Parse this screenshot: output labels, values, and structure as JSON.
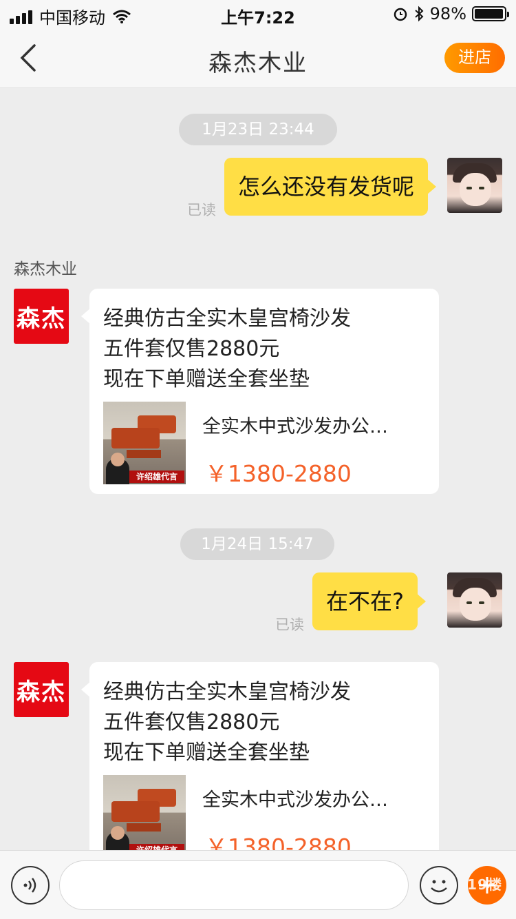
{
  "status_bar": {
    "carrier": "中国移动",
    "time": "上午7:22",
    "battery": "98%",
    "battery_level": 0.98
  },
  "nav": {
    "title": "森杰木业",
    "enter_shop_label": "进店"
  },
  "shop_avatar_text": "森杰",
  "messages": [
    {
      "timestamp": "1月23日 23:44",
      "mine": {
        "text": "怎么还没有发货呢",
        "status": "已读"
      },
      "sender_name": "森杰木业",
      "card": {
        "lines": [
          "经典仿古全实木皇宫椅沙发",
          "五件套仅售2880元",
          "现在下单赠送全套坐垫"
        ],
        "product_title": "全实木中式沙发办公…",
        "price": "￥1380-2880",
        "thumb_banner": "许绍雄代言"
      }
    },
    {
      "timestamp": "1月24日 15:47",
      "mine": {
        "text": "在不在?",
        "status": "已读"
      },
      "card": {
        "lines": [
          "经典仿古全实木皇宫椅沙发",
          "五件套仅售2880元",
          "现在下单赠送全套坐垫"
        ],
        "product_title": "全实木中式沙发办公…",
        "price": "￥1380-2880",
        "thumb_banner": "许绍雄代言"
      }
    }
  ],
  "input": {
    "placeholder": ""
  },
  "watermark": "19楼",
  "colors": {
    "accent": "#ff6a00",
    "my_bubble": "#ffde45",
    "price": "#f4622a",
    "shop_avatar": "#e50914"
  }
}
